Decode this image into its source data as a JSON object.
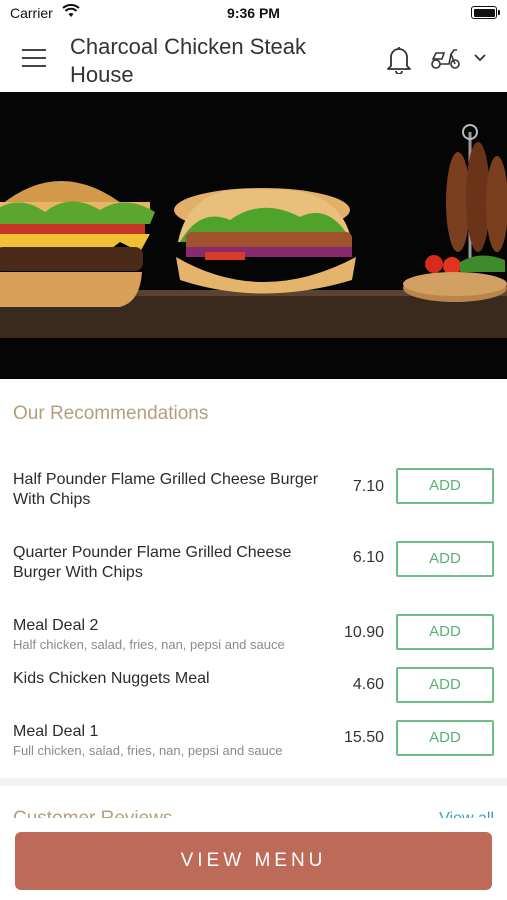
{
  "status_bar": {
    "carrier": "Carrier",
    "time": "9:36 PM"
  },
  "header": {
    "title": "Charcoal Chicken Steak House",
    "icons": [
      "menu-icon",
      "bell-icon",
      "scooter-icon",
      "chevron-down-icon"
    ]
  },
  "recommendations": {
    "title": "Our Recommendations",
    "items": [
      {
        "name": "Half Pounder Flame Grilled Cheese Burger With Chips",
        "description": "",
        "price": "7.10",
        "button": "ADD"
      },
      {
        "name": "Quarter Pounder Flame Grilled Cheese Burger With Chips",
        "description": "",
        "price": "6.10",
        "button": "ADD"
      },
      {
        "name": "Meal Deal 2",
        "description": "Half chicken, salad, fries, nan, pepsi and sauce",
        "price": "10.90",
        "button": "ADD"
      },
      {
        "name": "Kids Chicken Nuggets Meal",
        "description": "",
        "price": "4.60",
        "button": "ADD"
      },
      {
        "name": "Meal Deal 1",
        "description": "Full chicken, salad, fries, nan, pepsi and sauce",
        "price": "15.50",
        "button": "ADD"
      }
    ]
  },
  "reviews": {
    "title": "Customer Reviews",
    "view_all": "View all"
  },
  "footer": {
    "view_menu": "VIEW MENU"
  },
  "colors": {
    "accent_gold": "#b59e7e",
    "add_green": "#5ab074",
    "cta": "#bd6a58",
    "link": "#3a9fbf"
  }
}
